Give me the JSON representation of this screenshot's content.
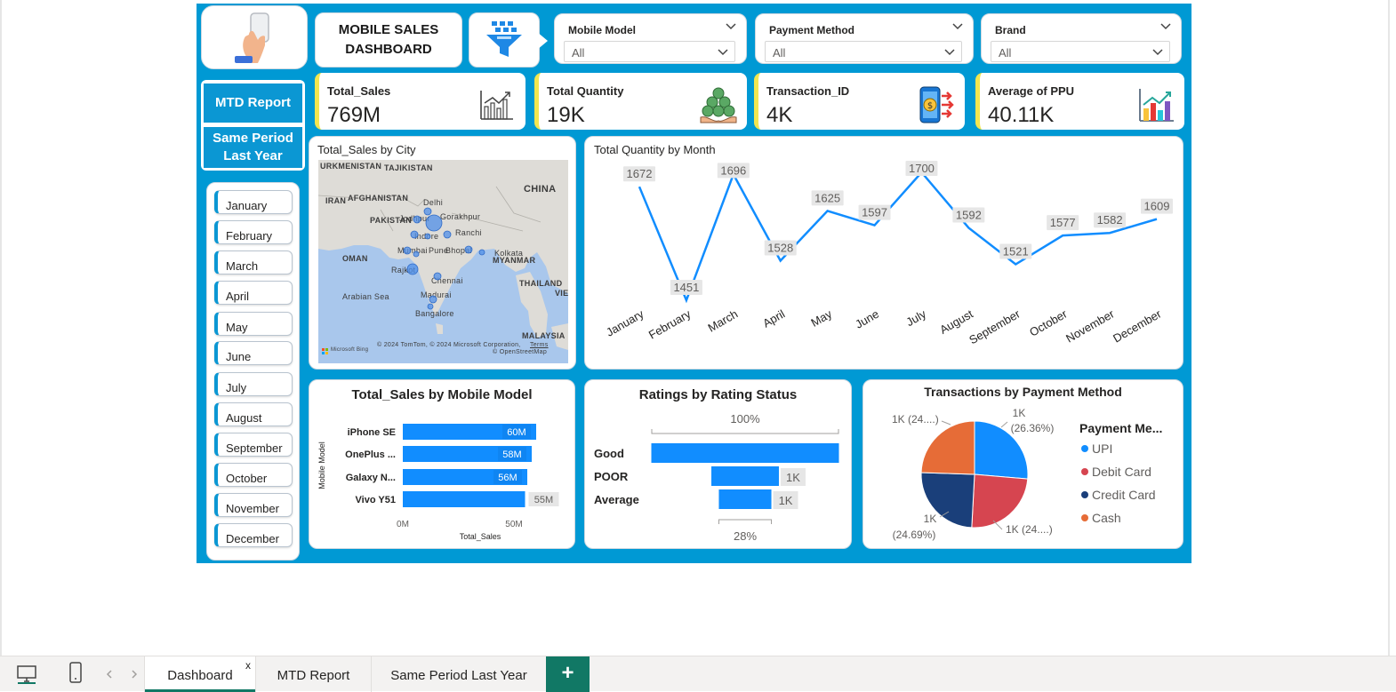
{
  "dashboard": {
    "title": "MOBILE SALES DASHBOARD",
    "accent_color": "#0099d4",
    "kpi_accent": "#f2e64f"
  },
  "filters": [
    {
      "label": "Mobile Model",
      "value": "All"
    },
    {
      "label": "Payment Method",
      "value": "All"
    },
    {
      "label": "Brand",
      "value": "All"
    }
  ],
  "nav": {
    "mtd_label": "MTD Report",
    "spl_label": "Same Period Last Year"
  },
  "months": [
    "January",
    "February",
    "March",
    "April",
    "May",
    "June",
    "July",
    "August",
    "September",
    "October",
    "November",
    "December"
  ],
  "kpis": [
    {
      "label": "Total_Sales",
      "value": "769M",
      "icon": "line-chart-icon"
    },
    {
      "label": "Total Quantity",
      "value": "19K",
      "icon": "coins-icon"
    },
    {
      "label": "Transaction_ID",
      "value": "4K",
      "icon": "phone-payment-icon"
    },
    {
      "label": "Average of PPU",
      "value": "40.11K",
      "icon": "bar-chart-icon"
    }
  ],
  "map": {
    "title": "Total_Sales by City",
    "labels": {
      "turkmenistan": "URKMENISTAN",
      "tajikistan": "TAJIKISTAN",
      "china": "CHINA",
      "iran": "IRAN",
      "afghanistan": "AFGHANISTAN",
      "pakistan": "PAKISTAN",
      "delhi": "Delhi",
      "jodhpur": "Jodhpur",
      "gorakhpur": "Gorakhpur",
      "indore": "Indore",
      "ranchi": "Ranchi",
      "mumbai": "Mumbai",
      "pune": "Pune",
      "bhopal": "Bhopal",
      "kolkata": "Kolkata",
      "oman": "OMAN",
      "myanmar": "MYANMAR",
      "rajkot": "Rajkot",
      "chennai": "Chennai",
      "thailand": "THAILAND",
      "arabian_sea": "Arabian Sea",
      "madurai": "Madurai",
      "bangalore": "Bangalore",
      "viet": "VIE",
      "malaysia": "MALAYSIA",
      "copyright": "© 2024 TomTom, © 2024 Microsoft Corporation,",
      "terms": "Terms",
      "osm": "© OpenStreetMap",
      "bing": "Microsoft Bing"
    }
  },
  "chart_data": [
    {
      "type": "line",
      "title": "Total Quantity by Month",
      "categories": [
        "January",
        "February",
        "March",
        "April",
        "May",
        "June",
        "July",
        "August",
        "September",
        "October",
        "November",
        "December"
      ],
      "values": [
        1672,
        1451,
        1696,
        1528,
        1625,
        1597,
        1700,
        1592,
        1521,
        1577,
        1582,
        1609
      ],
      "color": "#118dff"
    },
    {
      "type": "bar",
      "title": "Total_Sales by Mobile Model",
      "categories": [
        "iPhone SE",
        "OnePlus ...",
        "Galaxy N...",
        "Vivo Y51"
      ],
      "values": [
        60,
        58,
        56,
        55
      ],
      "data_labels": [
        "60M",
        "58M",
        "56M",
        "55M"
      ],
      "xlabel": "Total_Sales",
      "ylabel": "Mobile Model",
      "xticks": [
        "0M",
        "50M"
      ],
      "color": "#118dff"
    },
    {
      "type": "bar",
      "title": "Ratings by Rating Status",
      "categories": [
        "Good",
        "POOR",
        "Average"
      ],
      "values": [
        100,
        36,
        28
      ],
      "data_labels": [
        "",
        "1K",
        "1K"
      ],
      "top_label": "100%",
      "bottom_label": "28%",
      "color": "#118dff"
    },
    {
      "type": "pie",
      "title": "Transactions by Payment Method",
      "legend_title": "Payment Me...",
      "slices": [
        {
          "name": "UPI",
          "value": 26.36,
          "color": "#118dff",
          "label": "1K",
          "pct": "(26.36%)"
        },
        {
          "name": "Debit Card",
          "value": 24.48,
          "color": "#d64550",
          "label": "1K (24....)",
          "pct": ""
        },
        {
          "name": "Credit Card",
          "value": 24.69,
          "color": "#1a3f7a",
          "label": "1K",
          "pct": "(24.69%)"
        },
        {
          "name": "Cash",
          "value": 24.47,
          "color": "#e66c37",
          "label": "1K (24....)",
          "pct": ""
        }
      ]
    }
  ],
  "tabs": [
    {
      "label": "Dashboard",
      "close": "x"
    },
    {
      "label": "MTD Report"
    },
    {
      "label": "Same Period Last Year"
    }
  ],
  "add_tab": "+"
}
